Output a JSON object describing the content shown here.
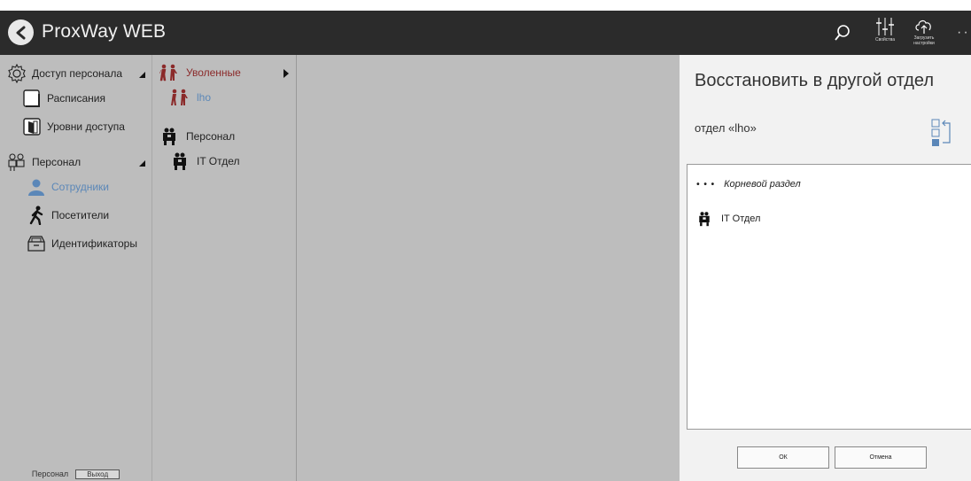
{
  "app": {
    "title": "ProxWay WEB"
  },
  "toolbar": {
    "properties_label": "Свойства",
    "upload_label": "Загрузить настройки",
    "more_label": "··"
  },
  "sidebar": {
    "groups": [
      {
        "label": "Доступ персонала",
        "items": [
          {
            "label": "Расписания"
          },
          {
            "label": "Уровни доступа"
          }
        ]
      },
      {
        "label": "Персонал",
        "items": [
          {
            "label": "Сотрудники"
          },
          {
            "label": "Посетители"
          },
          {
            "label": "Идентификаторы"
          }
        ]
      }
    ],
    "footer": {
      "user_label": "Персонал",
      "exit_label": "Выход"
    }
  },
  "tree": {
    "items": [
      {
        "label": "Уволенные"
      },
      {
        "label": "lho"
      },
      {
        "label": "Персонал"
      },
      {
        "label": "IT Отдел"
      }
    ]
  },
  "dialog": {
    "title": "Восстановить в другой отдел",
    "subtitle": "отдел «lho»",
    "list": [
      {
        "label": "Корневой раздел",
        "prefix": "• • •"
      },
      {
        "label": "IT Отдел"
      }
    ],
    "ok_label": "ОК",
    "cancel_label": "Отмена"
  },
  "colors": {
    "topbar": "#2b2b2b",
    "sidebar": "#bdbdbd",
    "active": "#5b87b8",
    "dismissed": "#8b2a2a",
    "panel": "#f2f2f2"
  }
}
